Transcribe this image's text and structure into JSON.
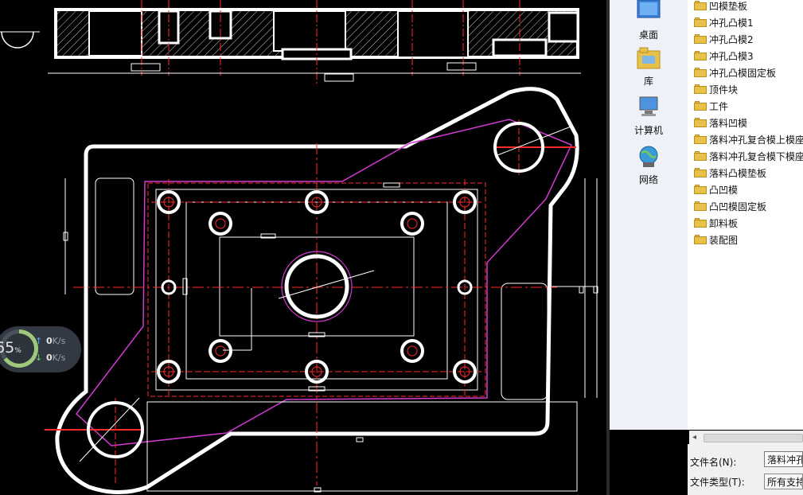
{
  "widget": {
    "percent": "65",
    "percent_unit": "%",
    "upload_arrow": "↑",
    "upload_rate": "0",
    "upload_unit": "K/s",
    "download_arrow": "↓",
    "download_rate": "0",
    "download_unit": "K/s"
  },
  "places": [
    {
      "label": "桌面",
      "icon": "desktop-icon"
    },
    {
      "label": "库",
      "icon": "library-icon"
    },
    {
      "label": "计算机",
      "icon": "computer-icon"
    },
    {
      "label": "网络",
      "icon": "network-icon"
    }
  ],
  "files": [
    "凹模垫板",
    "冲孔凸模1",
    "冲孔凸模2",
    "冲孔凸模3",
    "冲孔凸模固定板",
    "顶件块",
    "工件",
    "落料凹模",
    "落料冲孔复合模上模座",
    "落料冲孔复合模下模座",
    "落料凸模垫板",
    "凸凹模",
    "凸凹模固定板",
    "卸料板",
    "装配图"
  ],
  "form": {
    "filename_label": "文件名(N):",
    "filename_value": "落料冲孔",
    "filetype_label": "文件类型(T):",
    "filetype_value": "所有支持"
  },
  "scroll_left_arrow": "◂",
  "colors": {
    "cad_background": "#000000",
    "outline": "#ffffff",
    "centerline": "#ff2a2a",
    "contour": "#d23ad2",
    "folder": "#e8c14a"
  }
}
